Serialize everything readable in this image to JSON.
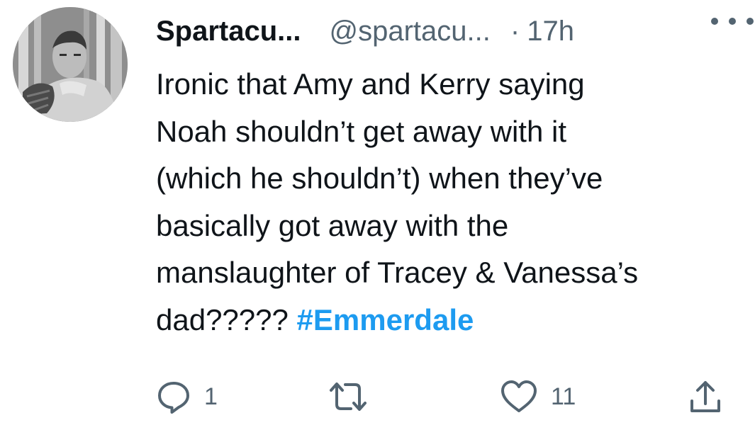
{
  "tweet": {
    "display_name": "Spartacu...",
    "handle": "@spartacu...",
    "separator": "·",
    "time": "17h",
    "more_icon": "more-horizontal-icon",
    "avatar_description_icon": "avatar",
    "body_lines": [
      "Ironic that Amy and Kerry saying",
      "Noah shouldn’t get away with it",
      "(which he shouldn’t) when they’ve",
      "basically got away with the",
      "manslaughter of Tracey & Vanessa’s"
    ],
    "last_line_text": "dad????? ",
    "hashtag": "#Emmerdale",
    "hashtag_color": "#1d9bf0",
    "text_color": "#0f1419",
    "secondary_color": "#536471"
  },
  "actions": {
    "reply": {
      "icon": "reply-icon",
      "count": "1"
    },
    "retweet": {
      "icon": "retweet-icon",
      "count": ""
    },
    "like": {
      "icon": "heart-icon",
      "count": "11"
    },
    "share": {
      "icon": "share-icon",
      "count": ""
    }
  }
}
